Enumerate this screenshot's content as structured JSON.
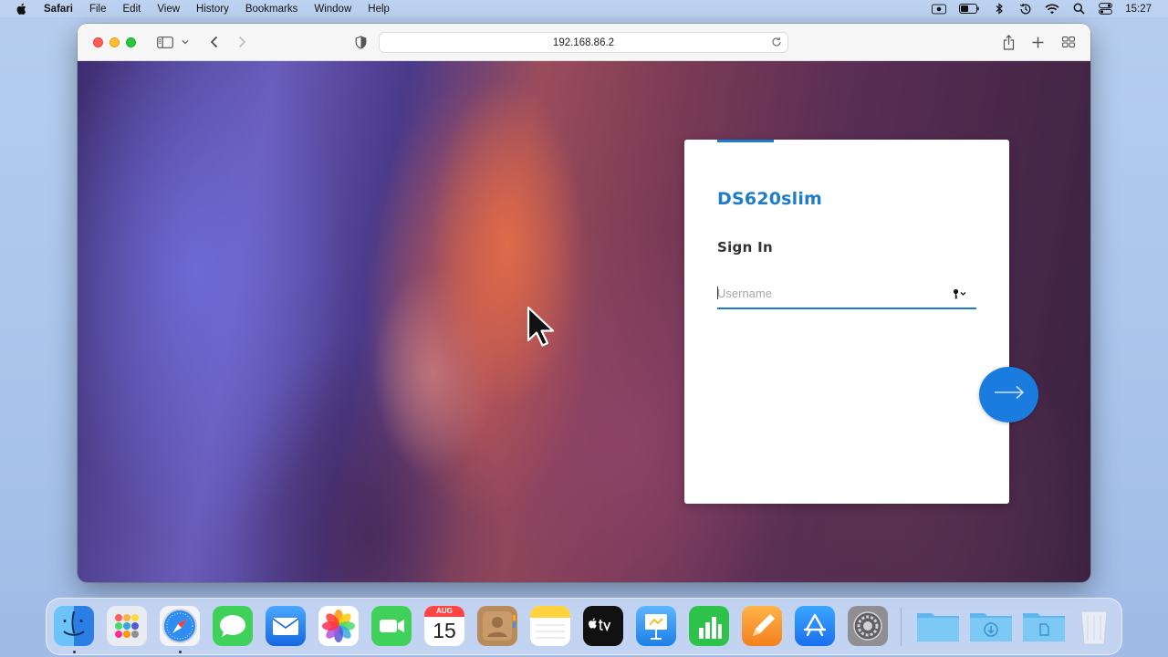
{
  "menubar": {
    "app_name": "Safari",
    "menus": [
      "File",
      "Edit",
      "View",
      "History",
      "Bookmarks",
      "Window",
      "Help"
    ],
    "clock": "15:27",
    "status_icons": [
      "screen-record-icon",
      "battery-icon",
      "bluetooth-icon",
      "time-machine-icon",
      "wifi-icon",
      "spotlight-search-icon",
      "control-center-icon"
    ]
  },
  "browser": {
    "url": "192.168.86.2"
  },
  "login": {
    "brand": "DS620slim",
    "heading": "Sign In",
    "username_placeholder": "Username",
    "username_value": ""
  },
  "dock": {
    "calendar_month": "AUG",
    "calendar_day": "15",
    "apps": [
      "Finder",
      "Launchpad",
      "Safari",
      "Messages",
      "Mail",
      "Photos",
      "FaceTime",
      "Calendar",
      "Contacts",
      "Notes",
      "Apple TV",
      "Keynote",
      "Numbers",
      "Pages",
      "App Store",
      "System Settings",
      "Applications",
      "Downloads",
      "Documents",
      "Trash"
    ]
  },
  "colors": {
    "accent": "#1d7bd1",
    "brand_text": "#1e7cc8"
  }
}
